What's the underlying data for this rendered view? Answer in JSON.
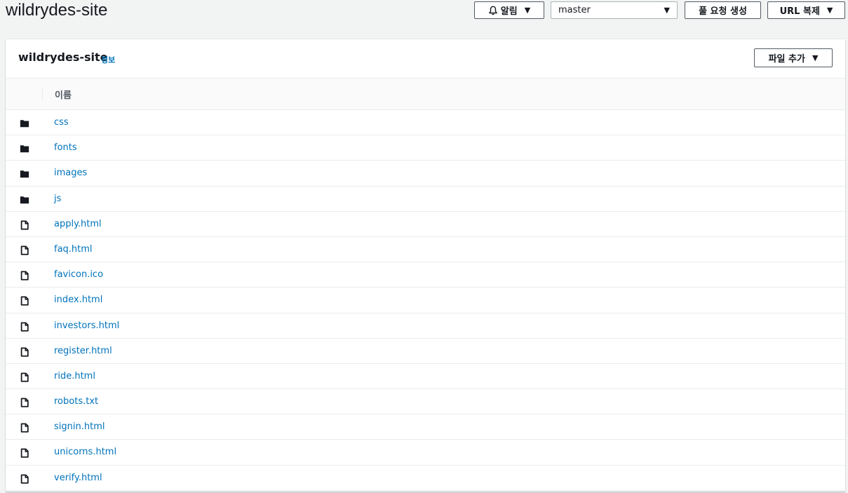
{
  "header": {
    "title": "wildrydes-site",
    "notify_label": "알림",
    "branch": "master",
    "pull_request_label": "풀 요청 생성",
    "clone_url_label": "URL 복제"
  },
  "panel": {
    "title": "wildrydes-site",
    "info_label": "정보",
    "add_file_label": "파일 추가",
    "column_name": "이름",
    "items": [
      {
        "type": "folder",
        "name": "css"
      },
      {
        "type": "folder",
        "name": "fonts"
      },
      {
        "type": "folder",
        "name": "images"
      },
      {
        "type": "folder",
        "name": "js"
      },
      {
        "type": "file",
        "name": "apply.html"
      },
      {
        "type": "file",
        "name": "faq.html"
      },
      {
        "type": "file",
        "name": "favicon.ico"
      },
      {
        "type": "file",
        "name": "index.html"
      },
      {
        "type": "file",
        "name": "investors.html"
      },
      {
        "type": "file",
        "name": "register.html"
      },
      {
        "type": "file",
        "name": "ride.html"
      },
      {
        "type": "file",
        "name": "robots.txt"
      },
      {
        "type": "file",
        "name": "signin.html"
      },
      {
        "type": "file",
        "name": "unicorns.html"
      },
      {
        "type": "file",
        "name": "verify.html"
      }
    ]
  },
  "colors": {
    "link": "#0073bb",
    "text": "#16191f",
    "border": "#eaeded",
    "background": "#f2f3f3"
  }
}
